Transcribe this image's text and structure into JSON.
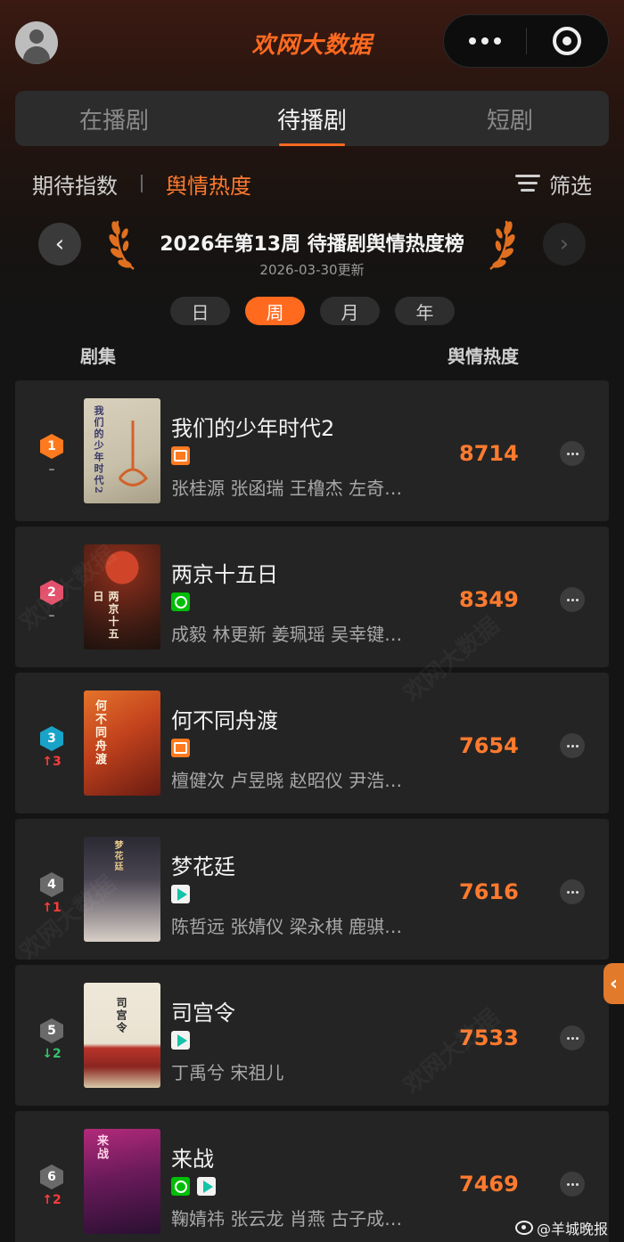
{
  "header": {
    "brand": "欢网大数据",
    "brand_mark": "↗"
  },
  "main_tabs": [
    {
      "label": "在播剧",
      "active": false
    },
    {
      "label": "待播剧",
      "active": true
    },
    {
      "label": "短剧",
      "active": false
    }
  ],
  "sub_tabs": [
    {
      "label": "期待指数",
      "active": false
    },
    {
      "label": "舆情热度",
      "active": true
    }
  ],
  "filter_label": "筛选",
  "board": {
    "title": "2026年第13周 待播剧舆情热度榜",
    "updated": "2026-03-30更新",
    "prev_icon": "‹",
    "next_icon": "›"
  },
  "period_tabs": [
    {
      "label": "日",
      "active": false
    },
    {
      "label": "周",
      "active": true
    },
    {
      "label": "月",
      "active": false
    },
    {
      "label": "年",
      "active": false
    }
  ],
  "columns": {
    "show": "剧集",
    "heat": "舆情热度"
  },
  "shows": [
    {
      "rank": "1",
      "change": "–",
      "title": "我们的少年时代2",
      "platforms": [
        "mango"
      ],
      "cast": "张桂源 张函瑞 王橹杰 左奇…",
      "heat": "8714",
      "poster_text": "我们的少年时代2"
    },
    {
      "rank": "2",
      "change": "–",
      "title": "两京十五日",
      "platforms": [
        "iqiyi"
      ],
      "cast": "成毅 林更新 姜珮瑶 吴幸键…",
      "heat": "8349",
      "poster_text": "两京十五日"
    },
    {
      "rank": "3",
      "change": "↑3",
      "title": "何不同舟渡",
      "platforms": [
        "mango"
      ],
      "cast": "檀健次 卢昱晓 赵昭仪 尹浩…",
      "heat": "7654",
      "poster_text": "何不同舟渡"
    },
    {
      "rank": "4",
      "change": "↑1",
      "title": "梦花廷",
      "platforms": [
        "tencent"
      ],
      "cast": "陈哲远 张婧仪 梁永棋 鹿骐…",
      "heat": "7616",
      "poster_text": "梦花廷"
    },
    {
      "rank": "5",
      "change": "↓2",
      "title": "司宫令",
      "platforms": [
        "tencent"
      ],
      "cast": "丁禹兮 宋祖儿",
      "heat": "7533",
      "poster_text": "司宫令"
    },
    {
      "rank": "6",
      "change": "↑2",
      "title": "来战",
      "platforms": [
        "iqiyi",
        "tencent"
      ],
      "cast": "鞠婧祎 张云龙 肖燕 古子成…",
      "heat": "7469",
      "poster_text": "来战"
    }
  ],
  "side_tab_icon": "‹",
  "watermark": "欢网大数据",
  "credit": "@羊城晚报",
  "colors": {
    "accent": "#ff6a1f",
    "heat": "#ff7a2e",
    "rank1": "#ff7a1f",
    "rank2": "#e2506b",
    "rank3": "#1aa3c8",
    "rank_other": "#6a6a6a",
    "up": "#ff3b3b",
    "down": "#35c36a"
  }
}
